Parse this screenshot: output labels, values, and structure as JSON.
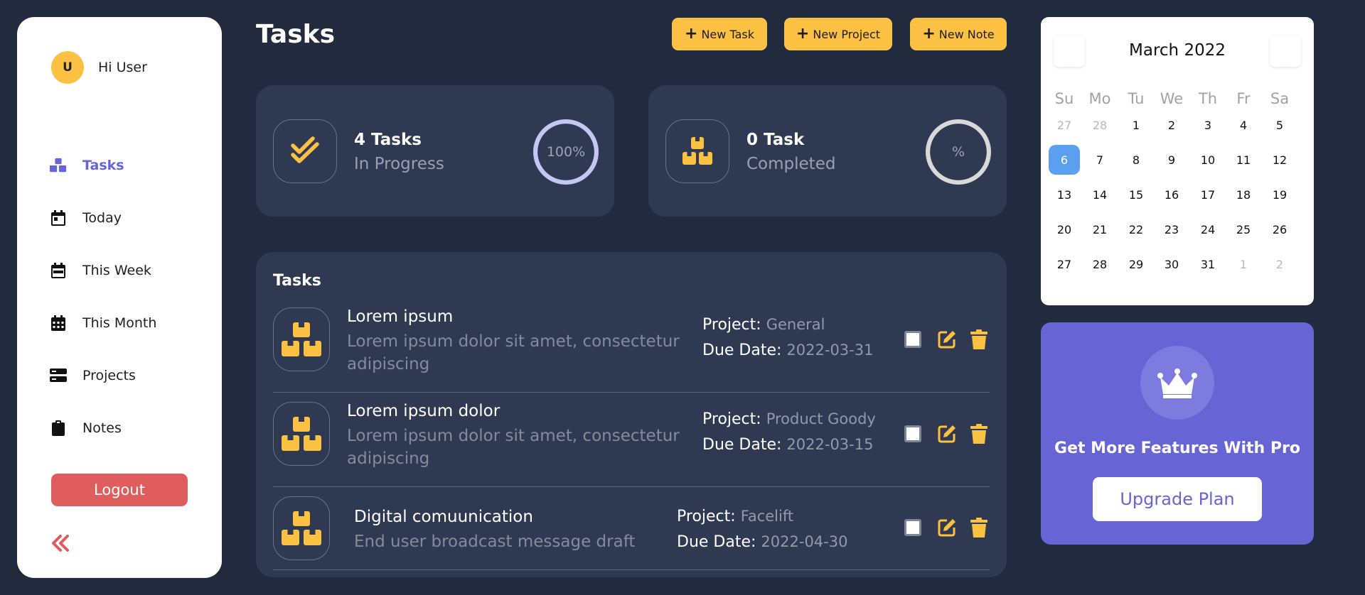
{
  "user": {
    "initial": "U",
    "greeting": "Hi User"
  },
  "nav": {
    "tasks": "Tasks",
    "today": "Today",
    "week": "This Week",
    "month": "This Month",
    "projects": "Projects",
    "notes": "Notes"
  },
  "logout": "Logout",
  "page_title": "Tasks",
  "actions": {
    "new_task": "New Task",
    "new_project": "New Project",
    "new_note": "New Note"
  },
  "stats": {
    "progress": {
      "title": "4 Tasks",
      "subtitle": "In Progress",
      "ring_label": "100%",
      "ring_fraction": 1.0
    },
    "completed": {
      "title": "0 Task",
      "subtitle": "Completed",
      "ring_label": "%",
      "ring_fraction": 0
    }
  },
  "tasks_panel": {
    "title": "Tasks",
    "project_label": "Project:",
    "due_label": "Due Date:",
    "rows": [
      {
        "name": "Lorem ipsum",
        "desc": "Lorem ipsum dolor sit amet, consectetur adipiscing",
        "project": "General",
        "due": "2022-03-31"
      },
      {
        "name": "Lorem ipsum dolor",
        "desc": "Lorem ipsum dolor sit amet, consectetur adipiscing",
        "project": "Product Goody",
        "due": "2022-03-15"
      },
      {
        "name": "Digital comuunication",
        "desc": "End user broadcast message draft",
        "project": "Facelift",
        "due": "2022-04-30"
      }
    ]
  },
  "calendar": {
    "month": "March 2022",
    "weekdays": [
      "Su",
      "Mo",
      "Tu",
      "We",
      "Th",
      "Fr",
      "Sa"
    ],
    "weeks": [
      [
        "27",
        "28",
        "1",
        "2",
        "3",
        "4",
        "5"
      ],
      [
        "6",
        "7",
        "8",
        "9",
        "10",
        "11",
        "12"
      ],
      [
        "13",
        "14",
        "15",
        "16",
        "17",
        "18",
        "19"
      ],
      [
        "20",
        "21",
        "22",
        "23",
        "24",
        "25",
        "26"
      ],
      [
        "27",
        "28",
        "29",
        "30",
        "31",
        "1",
        "2"
      ]
    ],
    "selected": "6"
  },
  "promo": {
    "text": "Get More Features With Pro",
    "button": "Upgrade Plan"
  },
  "colors": {
    "background": "#222b3e",
    "panel": "#2f3952",
    "accent_yellow": "#fcc143",
    "accent_purple": "#6764d6",
    "danger": "#e05d5e",
    "calendar_selected": "#5b9ff0"
  }
}
